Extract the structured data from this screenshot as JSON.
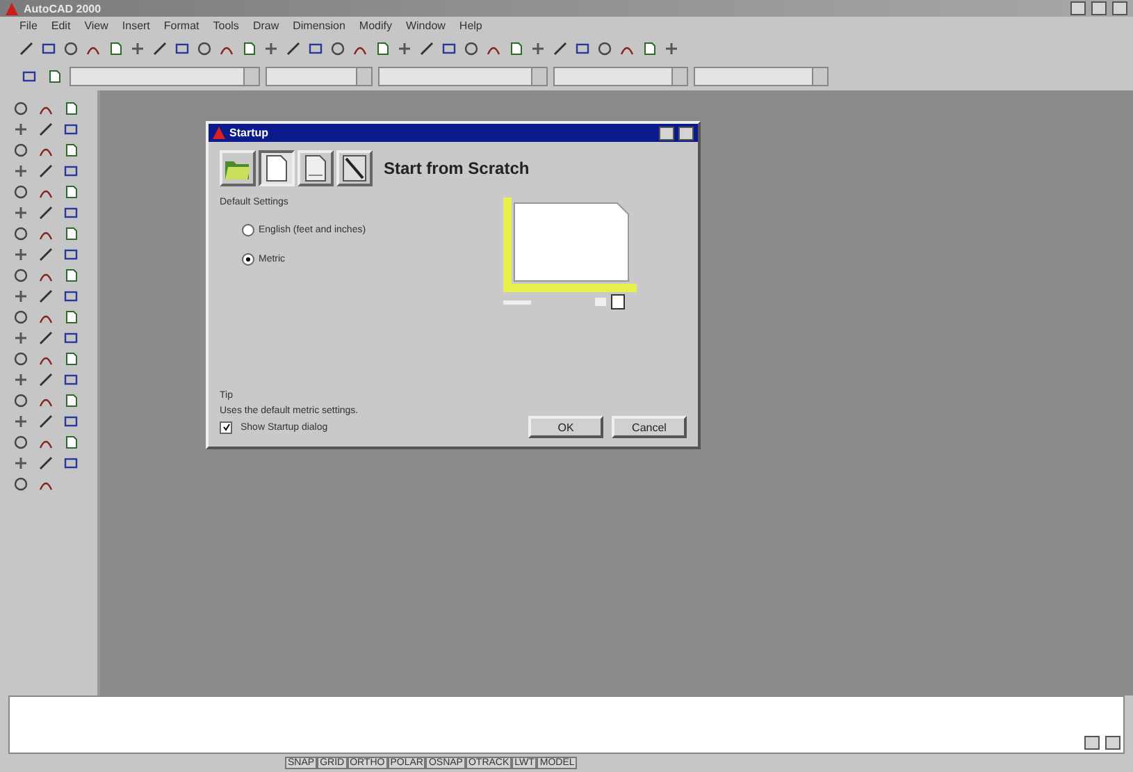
{
  "window": {
    "title": "AutoCAD 2000"
  },
  "menu": [
    "File",
    "Edit",
    "View",
    "Insert",
    "Format",
    "Tools",
    "Draw",
    "Dimension",
    "Modify",
    "Window",
    "Help"
  ],
  "dialog": {
    "title": "Startup",
    "tabs": [
      {
        "kind": "open",
        "selected": false
      },
      {
        "kind": "scratch",
        "selected": true
      },
      {
        "kind": "template",
        "selected": false
      },
      {
        "kind": "wizard",
        "selected": false
      }
    ],
    "heading": "Start from Scratch",
    "group_label": "Default Settings",
    "options": [
      {
        "label": "English (feet and inches)",
        "selected": false
      },
      {
        "label": "Metric",
        "selected": true
      }
    ],
    "tip_label": "Tip",
    "tip": "Uses the default metric settings.",
    "show_startup": {
      "label": "Show Startup dialog",
      "checked": true
    },
    "buttons": [
      "OK",
      "Cancel"
    ]
  },
  "status_bar": {
    "toggles": [
      "SNAP",
      "GRID",
      "ORTHO",
      "POLAR",
      "OSNAP",
      "OTRACK",
      "LWT",
      "MODEL"
    ]
  }
}
